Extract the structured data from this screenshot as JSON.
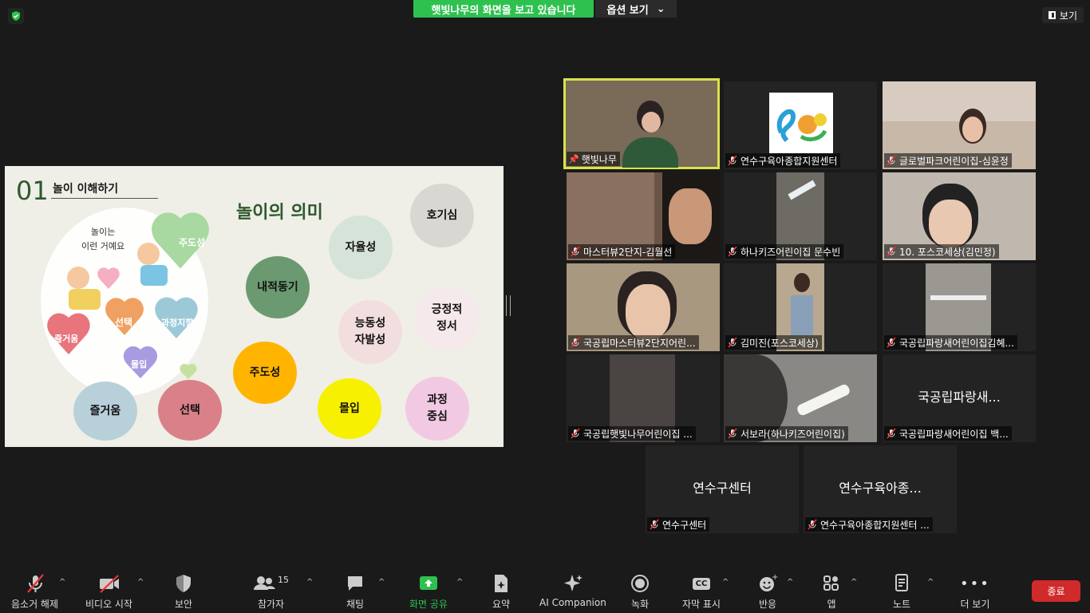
{
  "topbar": {
    "viewing_text": "햇빛나무의 화면을 보고 있습니다",
    "view_options_label": "옵션 보기",
    "view_label": "보기"
  },
  "slide": {
    "number": "01",
    "subtitle": "놀이 이해하기",
    "title": "놀이의 의미",
    "illustration_caption_line1": "놀이는",
    "illustration_caption_line2": "이런 거예요",
    "bubbles": [
      {
        "text": "호기심",
        "color": "#d9d7d2"
      },
      {
        "text": "자율성",
        "color": "#d6e3d8"
      },
      {
        "text": "내적동기",
        "color": "#6b9a70"
      },
      {
        "text": "능동성\n자발성",
        "color": "#f3dedf"
      },
      {
        "text": "긍정적\n정서",
        "color": "#f6e9ec"
      },
      {
        "text": "주도성",
        "color": "#ffb400"
      },
      {
        "text": "즐거움",
        "color": "#b8d0da"
      },
      {
        "text": "선택",
        "color": "#d98088"
      },
      {
        "text": "몰입",
        "color": "#f7f000"
      },
      {
        "text": "과정\n중심",
        "color": "#f2c9e3"
      }
    ],
    "hearts": [
      "주도성",
      "선택",
      "과정지향",
      "즐거움",
      "몰입"
    ]
  },
  "participants": [
    {
      "name": "햇빛나무",
      "muted": false,
      "pinned": true
    },
    {
      "name": "연수구육아종합지원센터",
      "muted": true
    },
    {
      "name": "글로벌파크어린이집-심윤정",
      "muted": true
    },
    {
      "name": "마스터뷰2단지-김월선",
      "muted": true
    },
    {
      "name": "하나키즈어린이집 문수빈",
      "muted": true
    },
    {
      "name": "10. 포스코세상(김민정)",
      "muted": true
    },
    {
      "name": "국공립마스터뷰2단지어린...",
      "muted": true
    },
    {
      "name": "김미진(포스코세상)",
      "muted": true
    },
    {
      "name": "국공립파랑새어린이집김혜...",
      "muted": true
    },
    {
      "name": "국공립햇빛나무어린이집 ...",
      "muted": true
    },
    {
      "name": "서보라(하나키즈어린이집)",
      "muted": true
    },
    {
      "name": "국공립파랑새어린이집 백...",
      "muted": true,
      "display": "국공립파랑새..."
    },
    {
      "name": "연수구센터",
      "muted": true,
      "display": "연수구센터"
    },
    {
      "name": "연수구육아종합지원센터 ...",
      "muted": true,
      "display": "연수구육아종..."
    }
  ],
  "toolbar": {
    "mute": "음소거 해제",
    "video": "비디오 시작",
    "security": "보안",
    "participants": "참가자",
    "participants_count": "15",
    "chat": "채팅",
    "share": "화면 공유",
    "summary": "요약",
    "ai": "AI Companion",
    "record": "녹화",
    "captions": "자막 표시",
    "reactions": "반응",
    "apps": "앱",
    "notes": "노트",
    "more": "더 보기",
    "end": "종료"
  },
  "colors": {
    "share_green": "#2ec14f",
    "end_red": "#d12a2a",
    "active_speaker": "#d8e34a"
  }
}
